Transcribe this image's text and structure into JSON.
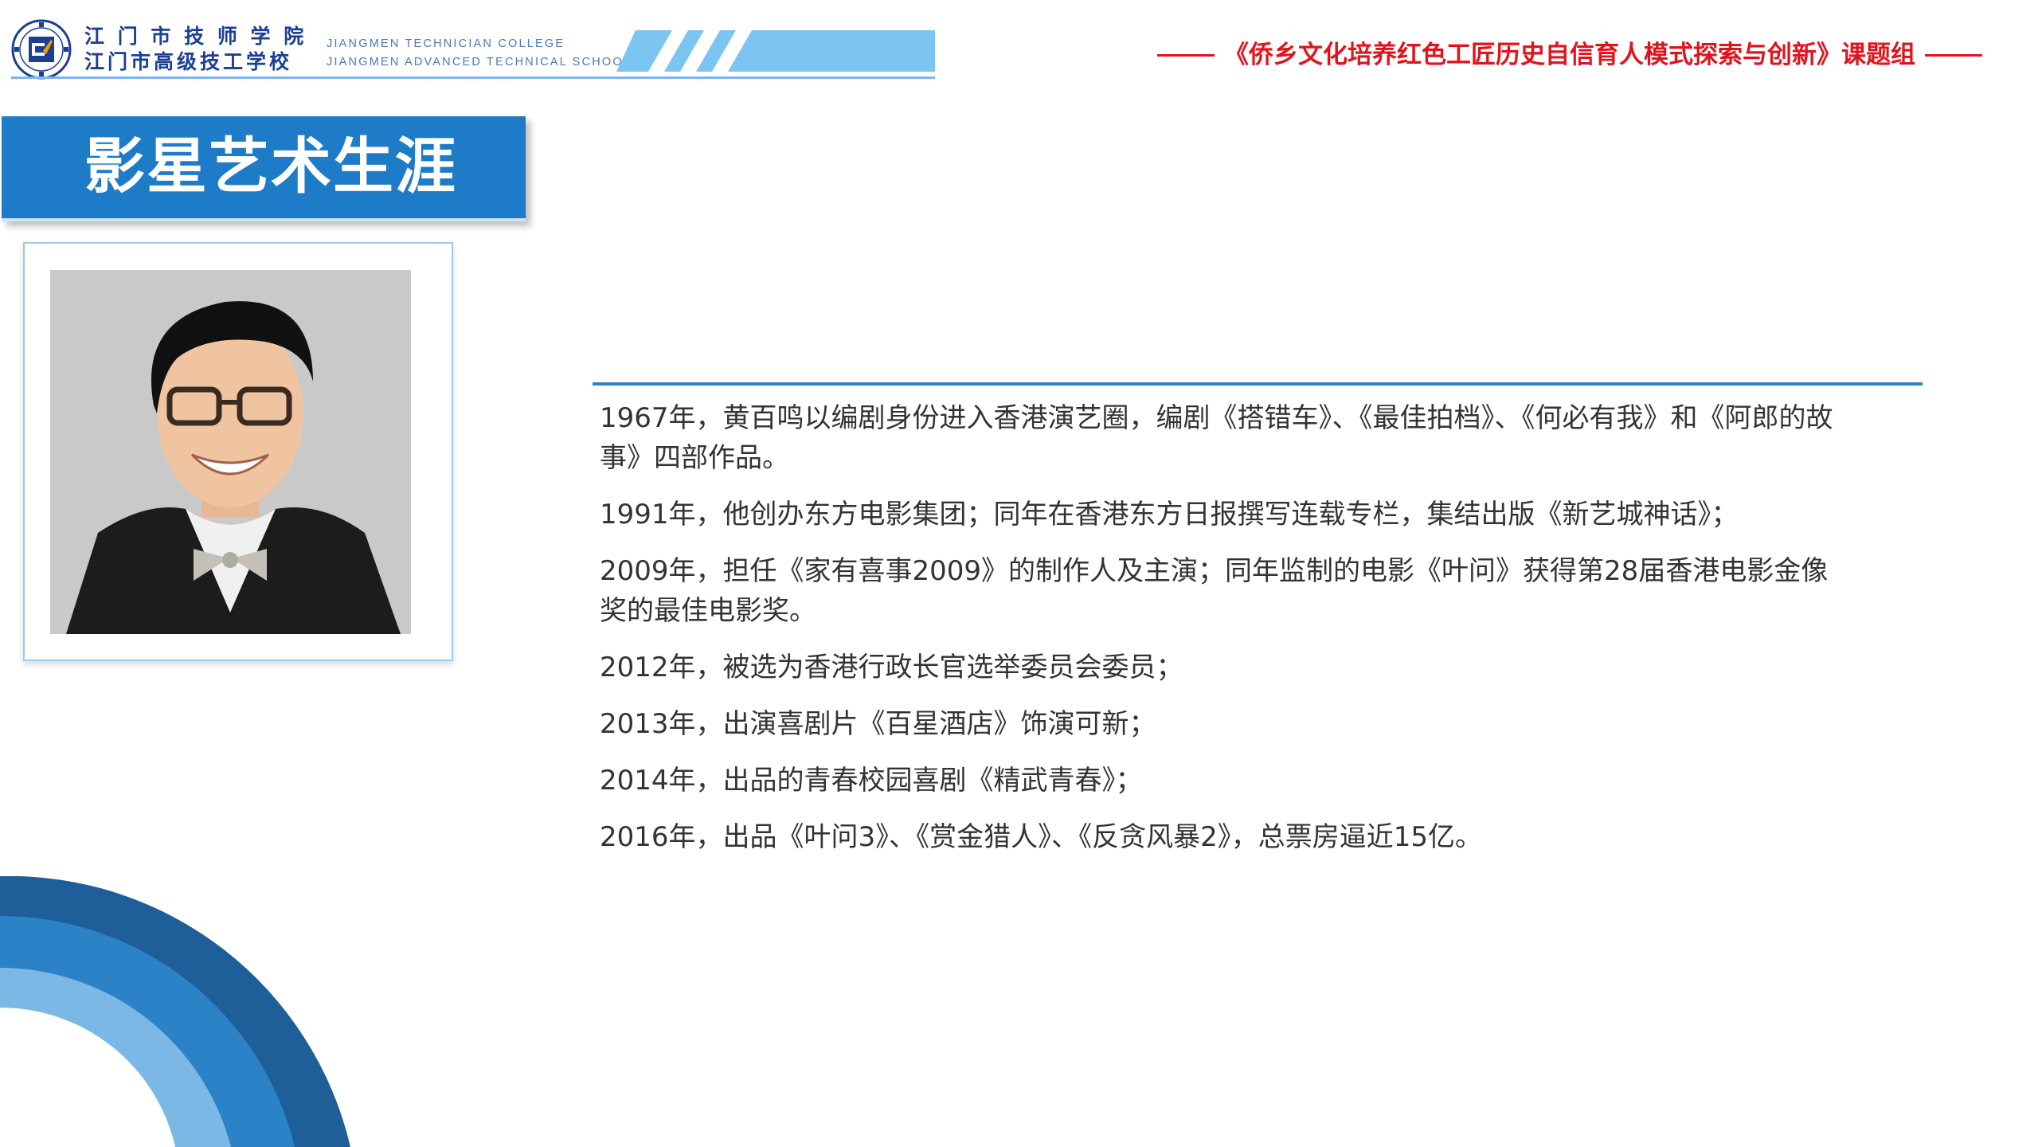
{
  "header": {
    "school_cn_1": "江 门 市 技 师 学 院",
    "school_cn_2": "江门市高级技工学校",
    "school_en_1": "JIANGMEN TECHNICIAN COLLEGE",
    "school_en_2": "JIANGMEN ADVANCED TECHNICAL SCHOOL",
    "project_title": "《侨乡文化培养红色工匠历史自信育人模式探索与创新》课题组"
  },
  "section_title": "影星艺术生涯",
  "timeline": [
    "1967年，黄百鸣以编剧身份进入香港演艺圈，编剧《搭错车》、《最佳拍档》、《何必有我》和《阿郎的故事》四部作品。",
    "1991年，他创办东方电影集团；同年在香港东方日报撰写连载专栏，集结出版《新艺城神话》；",
    "2009年，担任《家有喜事2009》的制作人及主演；同年监制的电影《叶问》获得第28届香港电影金像奖的最佳电影奖。",
    "2012年，被选为香港行政长官选举委员会委员；",
    "2013年，出演喜剧片《百星酒店》饰演可新；",
    "2014年，出品的青春校园喜剧《精武青春》；",
    "2016年，出品《叶问3》、《赏金猎人》、《反贪风暴2》，总票房逼近15亿。"
  ],
  "colors": {
    "accent_blue": "#1d7bc8",
    "title_red": "#e0141c",
    "logo_navy": "#1b3f93"
  }
}
